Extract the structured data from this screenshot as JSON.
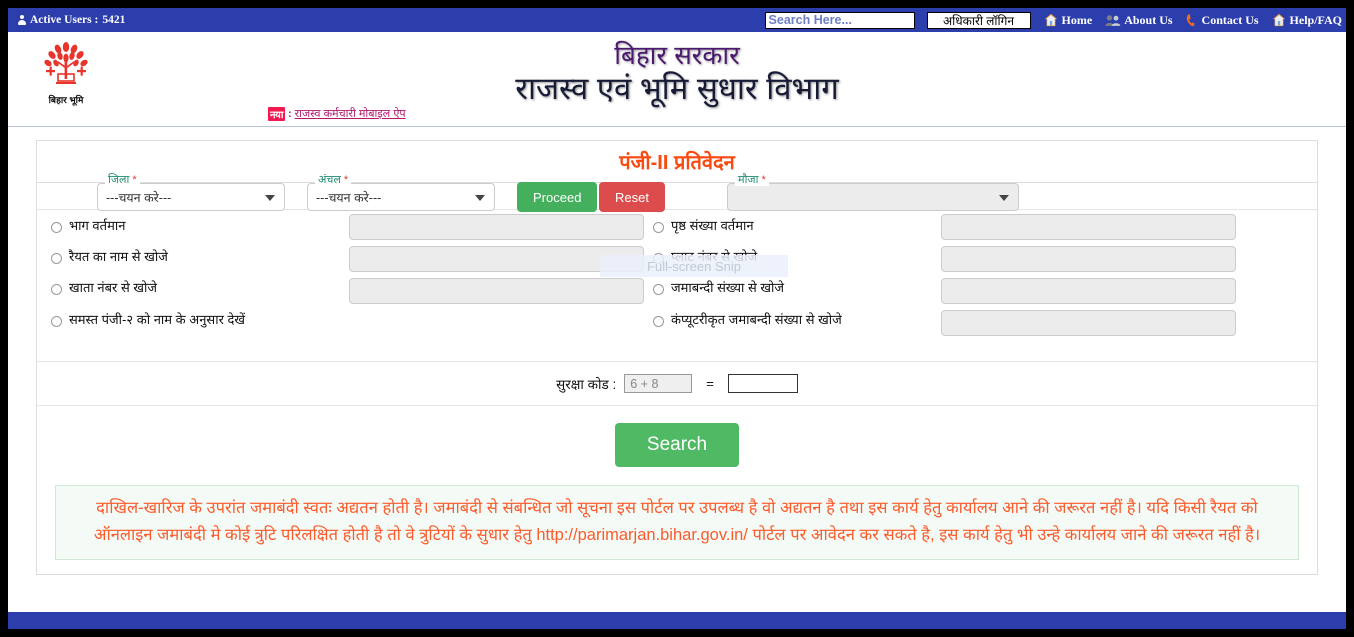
{
  "topbar": {
    "active_users_label": "Active Users :",
    "active_users_count": "5421",
    "search_placeholder": "Search Here...",
    "search_value": "",
    "officer_login": "अधिकारी लॉगिन",
    "nav": [
      {
        "label": "Home",
        "icon": "house-icon"
      },
      {
        "label": "About Us",
        "icon": "people-icon"
      },
      {
        "label": "Contact Us",
        "icon": "phone-icon"
      },
      {
        "label": "Help/FAQ",
        "icon": "house-icon"
      }
    ]
  },
  "header": {
    "logo_caption": "बिहार भूमि",
    "logo_icon": "bihar-bhumi-tree-emblem",
    "title_line1": "बिहार सरकार",
    "title_line2": "राजस्व एवं भूमि सुधार विभाग",
    "marquee_badge": "नया",
    "marquee_separator": ":",
    "marquee_link": "राजस्व कर्मचारी मोबाइल ऐप"
  },
  "panel": {
    "title": "पंजी-II प्रतिवेदन",
    "filters": {
      "jila_legend": "जिला",
      "jila_value": "---चयन करे---",
      "anchal_legend": "अंचल",
      "anchal_value": "---चयन करे---",
      "mauja_legend": "मौजा",
      "mauja_value": "",
      "required_star": "*",
      "proceed_label": "Proceed",
      "reset_label": "Reset"
    },
    "options_left": [
      {
        "label": "भाग वर्तमान",
        "has_input": true
      },
      {
        "label": "रैयत का नाम से खोजे",
        "has_input": true
      },
      {
        "label": "खाता नंबर से खोजे",
        "has_input": true
      },
      {
        "label": "समस्त पंजी-२ को नाम के अनुसार देखें",
        "has_input": false
      }
    ],
    "options_right": [
      {
        "label": "पृष्ठ संख्या वर्तमान",
        "has_input": true
      },
      {
        "label": "प्लाट नंबर से खोजे",
        "has_input": true
      },
      {
        "label": "जमाबन्दी संख्या से खोजे",
        "has_input": true
      },
      {
        "label": "कंप्यूटरीकृत जमाबन्दी संख्या से खोजे",
        "has_input": true
      }
    ],
    "captcha": {
      "label": "सुरक्षा कोड :",
      "question": "6 + 8",
      "equals": "=",
      "answer": ""
    },
    "search_label": "Search"
  },
  "notice": {
    "part1": "दाखिल-खारिज के उपरांत जमाबंदी स्वतः अद्यतन होती है। जमाबंदी से संबन्धित जो सूचना इस पोर्टल पर उपलब्ध है वो अद्यतन है तथा इस कार्य हेतु कार्यालय आने की जरूरत नहीं है। यदि किसी रैयत को ऑनलाइन जमाबंदी मे कोई त्रुटि परिलक्षित होती है तो वे त्रुटियों के सुधार हेतु ",
    "url": "http://parimarjan.bihar.gov.in/",
    "part2": " पोर्टल पर आवेदन कर सकते है, इस कार्य हेतु भी उन्हे कार्यालय जाने की जरूरत नहीं है।"
  },
  "overlay": {
    "snip_tooltip": "Full-screen Snip"
  },
  "colors": {
    "brand_blue": "#2c3dac",
    "panel_title": "#fa4a10",
    "green": "#4fb963",
    "red": "#dc4c4c",
    "notice_text": "#fb5a2b",
    "legend_teal": "#1f8a70",
    "title_purple": "#4b1a6f"
  }
}
